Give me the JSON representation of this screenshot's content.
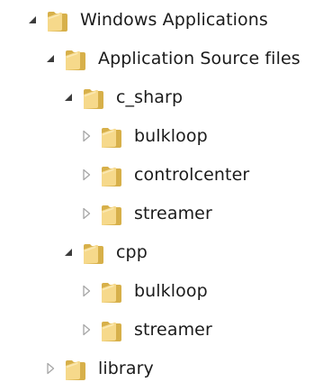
{
  "tree": {
    "nodes": [
      {
        "label": "Windows Applications",
        "state": "expanded",
        "depth": 0
      },
      {
        "label": "Application Source files",
        "state": "expanded",
        "depth": 1
      },
      {
        "label": "c_sharp",
        "state": "expanded",
        "depth": 2
      },
      {
        "label": "bulkloop",
        "state": "collapsed",
        "depth": 3
      },
      {
        "label": "controlcenter",
        "state": "collapsed",
        "depth": 3
      },
      {
        "label": "streamer",
        "state": "collapsed",
        "depth": 3
      },
      {
        "label": "cpp",
        "state": "expanded",
        "depth": 2
      },
      {
        "label": "bulkloop",
        "state": "collapsed",
        "depth": 3
      },
      {
        "label": "streamer",
        "state": "collapsed",
        "depth": 3
      },
      {
        "label": "library",
        "state": "collapsed",
        "depth": 1
      }
    ]
  },
  "icons": {
    "expanded": "expanded-triangle-icon",
    "collapsed": "collapsed-triangle-icon",
    "folder": "folder-icon"
  },
  "colors": {
    "text": "#1b1b1b",
    "expanded_triangle": "#3c3c3c",
    "collapsed_triangle": "#a6a6a6",
    "folder_back": "#d7b04a",
    "folder_front": "#f6d98b",
    "folder_front_light": "#fbe9b6"
  }
}
